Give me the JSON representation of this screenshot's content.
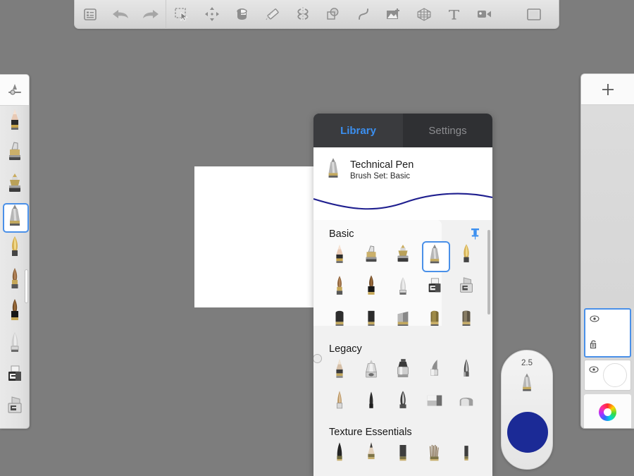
{
  "app": {
    "background_color": "#7d7d7d",
    "accent_color": "#4a90e8",
    "stroke_color": "#1f1f8f"
  },
  "toolbar": {
    "items": [
      {
        "name": "layers-list-icon",
        "label": "Layers List"
      },
      {
        "name": "undo-icon",
        "label": "Undo"
      },
      {
        "name": "redo-icon",
        "label": "Redo"
      },
      {
        "name": "select-icon",
        "label": "Select"
      },
      {
        "name": "transform-icon",
        "label": "Transform"
      },
      {
        "name": "fill-bucket-icon",
        "label": "Fill"
      },
      {
        "name": "eraser-icon",
        "label": "Eraser"
      },
      {
        "name": "symmetry-icon",
        "label": "Symmetry"
      },
      {
        "name": "shapes-icon",
        "label": "Shapes"
      },
      {
        "name": "curve-icon",
        "label": "Curve"
      },
      {
        "name": "add-image-icon",
        "label": "Add Image"
      },
      {
        "name": "perspective-grid-icon",
        "label": "Perspective Grid"
      },
      {
        "name": "text-icon",
        "label": "Text"
      },
      {
        "name": "record-icon",
        "label": "Record"
      },
      {
        "name": "fullscreen-icon",
        "label": "Fullscreen"
      }
    ]
  },
  "left_rail": {
    "top_tool": {
      "name": "brush-settings-icon",
      "label": "Brush Settings"
    },
    "brushes": [
      {
        "name": "pencil-brush",
        "label": "Pencil",
        "selected": false
      },
      {
        "name": "inking-pen-brush",
        "label": "Inking Pen",
        "selected": false
      },
      {
        "name": "fountain-nib-brush",
        "label": "Fountain Nib",
        "selected": false
      },
      {
        "name": "technical-pen-brush",
        "label": "Technical Pen",
        "selected": true
      },
      {
        "name": "calligraphy-nib-brush",
        "label": "Calligraphy Nib",
        "selected": false
      },
      {
        "name": "round-brush",
        "label": "Round Brush",
        "selected": false
      },
      {
        "name": "oil-brush",
        "label": "Oil Brush",
        "selected": false
      },
      {
        "name": "airbrush-brush",
        "label": "Airbrush",
        "selected": false
      },
      {
        "name": "marker-brush",
        "label": "Marker",
        "selected": false
      },
      {
        "name": "flat-marker-brush",
        "label": "Flat Marker",
        "selected": false
      }
    ]
  },
  "library": {
    "tabs": [
      {
        "label": "Library",
        "active": true
      },
      {
        "label": "Settings",
        "active": false
      }
    ],
    "current_brush": {
      "name": "Technical Pen",
      "set_label": "Brush Set: Basic"
    },
    "pin_icon": "pin-icon",
    "sections": [
      {
        "title": "Basic",
        "rows": [
          [
            {
              "name": "pencil",
              "selected": false
            },
            {
              "name": "inking-pen",
              "selected": false
            },
            {
              "name": "tech-pen-alt",
              "selected": false
            },
            {
              "name": "technical-pen",
              "selected": true
            },
            {
              "name": "calligraphy-nib",
              "selected": false
            }
          ],
          [
            {
              "name": "round-brush",
              "selected": false
            },
            {
              "name": "oil-brush",
              "selected": false
            },
            {
              "name": "airbrush",
              "selected": false
            },
            {
              "name": "marker",
              "selected": false
            },
            {
              "name": "flat-marker",
              "selected": false
            }
          ],
          [
            {
              "name": "blender-a",
              "selected": false
            },
            {
              "name": "blender-b",
              "selected": false
            },
            {
              "name": "blender-c",
              "selected": false
            },
            {
              "name": "blender-d",
              "selected": false
            },
            {
              "name": "blender-e",
              "selected": false
            }
          ]
        ]
      },
      {
        "title": "Legacy",
        "rows": [
          [
            {
              "name": "legacy-pencil",
              "selected": false
            },
            {
              "name": "legacy-inker",
              "selected": false
            },
            {
              "name": "legacy-spray",
              "selected": false
            },
            {
              "name": "legacy-chisel",
              "selected": false
            },
            {
              "name": "legacy-bullet",
              "selected": false
            }
          ],
          [
            {
              "name": "legacy-taper",
              "selected": false
            },
            {
              "name": "legacy-fine-tip",
              "selected": false
            },
            {
              "name": "legacy-nib",
              "selected": false
            },
            {
              "name": "legacy-flat",
              "selected": false
            },
            {
              "name": "legacy-round-flat",
              "selected": false
            }
          ]
        ]
      },
      {
        "title": "Texture Essentials",
        "rows": [
          [
            {
              "name": "texture-cone",
              "selected": false
            },
            {
              "name": "texture-pencil",
              "selected": false
            },
            {
              "name": "texture-block",
              "selected": false
            },
            {
              "name": "texture-bristle",
              "selected": false
            },
            {
              "name": "texture-narrow",
              "selected": false
            }
          ]
        ]
      }
    ]
  },
  "puck": {
    "size_value": "2.5",
    "brush_icon": "technical-pen-preview",
    "color_hex": "#1b2a96"
  },
  "right_panel": {
    "add_label": "+",
    "layers": [
      {
        "name": "layer-1",
        "visible": true,
        "locked": true,
        "selected": true
      },
      {
        "name": "layer-2",
        "visible": true,
        "locked": false,
        "selected": false
      }
    ],
    "color_wheel_icon": "color-wheel-icon"
  }
}
